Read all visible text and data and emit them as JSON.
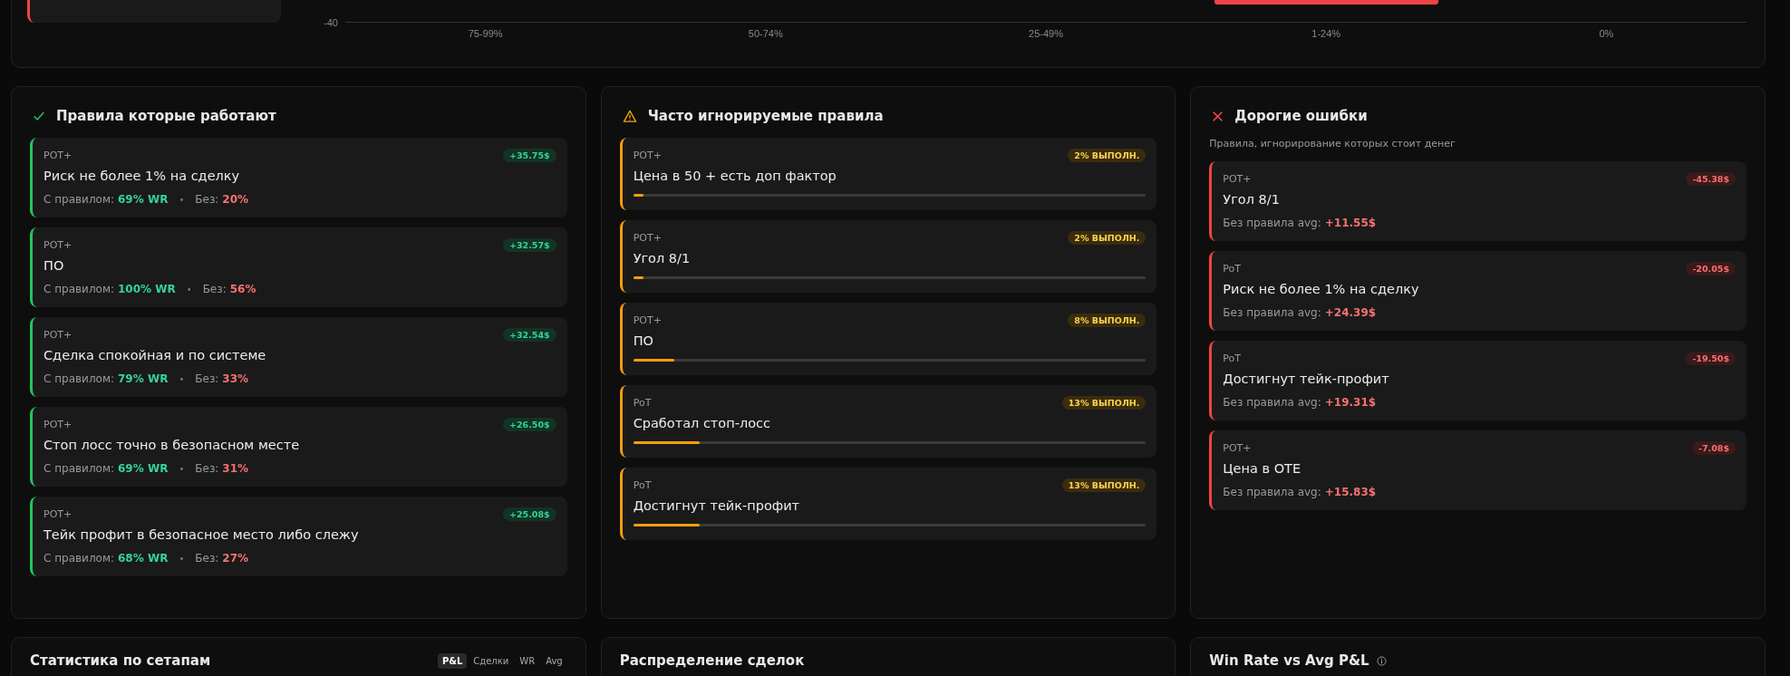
{
  "top_chart": {
    "y_tick": "-40",
    "categories": [
      "75-99%",
      "50-74%",
      "25-49%",
      "1-24%",
      "0%"
    ]
  },
  "panels": [
    {
      "kind": "working",
      "title": "Правила которые работают",
      "items": [
        {
          "tag": "POT+",
          "name": "Риск не более 1% на сделку",
          "amount": "+35.75$",
          "with_label": "С правилом:",
          "with_value": "69% WR",
          "sep": "•",
          "without_label": "Без:",
          "without_value": "20%"
        },
        {
          "tag": "POT+",
          "name": "ПО",
          "amount": "+32.57$",
          "with_label": "С правилом:",
          "with_value": "100% WR",
          "sep": "•",
          "without_label": "Без:",
          "without_value": "56%"
        },
        {
          "tag": "POT+",
          "name": "Сделка спокойная и по системе",
          "amount": "+32.54$",
          "with_label": "С правилом:",
          "with_value": "79% WR",
          "sep": "•",
          "without_label": "Без:",
          "without_value": "33%"
        },
        {
          "tag": "POT+",
          "name": "Стоп лосс точно в безопасном месте",
          "amount": "+26.50$",
          "with_label": "С правилом:",
          "with_value": "69% WR",
          "sep": "•",
          "without_label": "Без:",
          "without_value": "31%"
        },
        {
          "tag": "POT+",
          "name": "Тейк профит в безопасное место либо слежу",
          "amount": "+25.08$",
          "with_label": "С правилом:",
          "with_value": "68% WR",
          "sep": "•",
          "without_label": "Без:",
          "without_value": "27%"
        }
      ]
    },
    {
      "kind": "ignored",
      "title": "Часто игнорируемые правила",
      "items": [
        {
          "tag": "POT+",
          "name": "Цена в 50 + есть доп фактор",
          "badge": "2% ВЫПОЛН.",
          "level": 0.02
        },
        {
          "tag": "POT+",
          "name": "Угол 8/1",
          "badge": "2% ВЫПОЛН.",
          "level": 0.02
        },
        {
          "tag": "POT+",
          "name": "ПО",
          "badge": "8% ВЫПОЛН.",
          "level": 0.08
        },
        {
          "tag": "PoT",
          "name": "Сработал стоп-лосс",
          "badge": "13% ВЫПОЛН.",
          "level": 0.13
        },
        {
          "tag": "PoT",
          "name": "Достигнут тейк-профит",
          "badge": "13% ВЫПОЛН.",
          "level": 0.13
        }
      ]
    },
    {
      "kind": "costly",
      "title": "Дорогие ошибки",
      "subtitle": "Правила, игнорирование которых стоит денег",
      "items": [
        {
          "tag": "POT+",
          "name": "Угол 8/1",
          "amount": "-45.38$",
          "avg_label": "Без правила avg:",
          "avg_value": "+11.55$"
        },
        {
          "tag": "PoT",
          "name": "Риск не более 1% на сделку",
          "amount": "-20.05$",
          "avg_label": "Без правила avg:",
          "avg_value": "+24.39$"
        },
        {
          "tag": "PoT",
          "name": "Достигнут тейк-профит",
          "amount": "-19.50$",
          "avg_label": "Без правила avg:",
          "avg_value": "+19.31$"
        },
        {
          "tag": "POT+",
          "name": "Цена в OTE",
          "amount": "-7.08$",
          "avg_label": "Без правила avg:",
          "avg_value": "+15.83$"
        }
      ]
    }
  ],
  "bottom_panels": [
    {
      "title": "Статистика по сетапам",
      "tabs": [
        {
          "label": "P&L",
          "selected": true
        },
        {
          "label": "Сделки",
          "selected": false
        },
        {
          "label": "WR",
          "selected": false
        },
        {
          "label": "Avg",
          "selected": false
        }
      ]
    },
    {
      "title": "Распределение сделок"
    },
    {
      "title": "Win Rate vs Avg P&L",
      "info": true
    }
  ]
}
